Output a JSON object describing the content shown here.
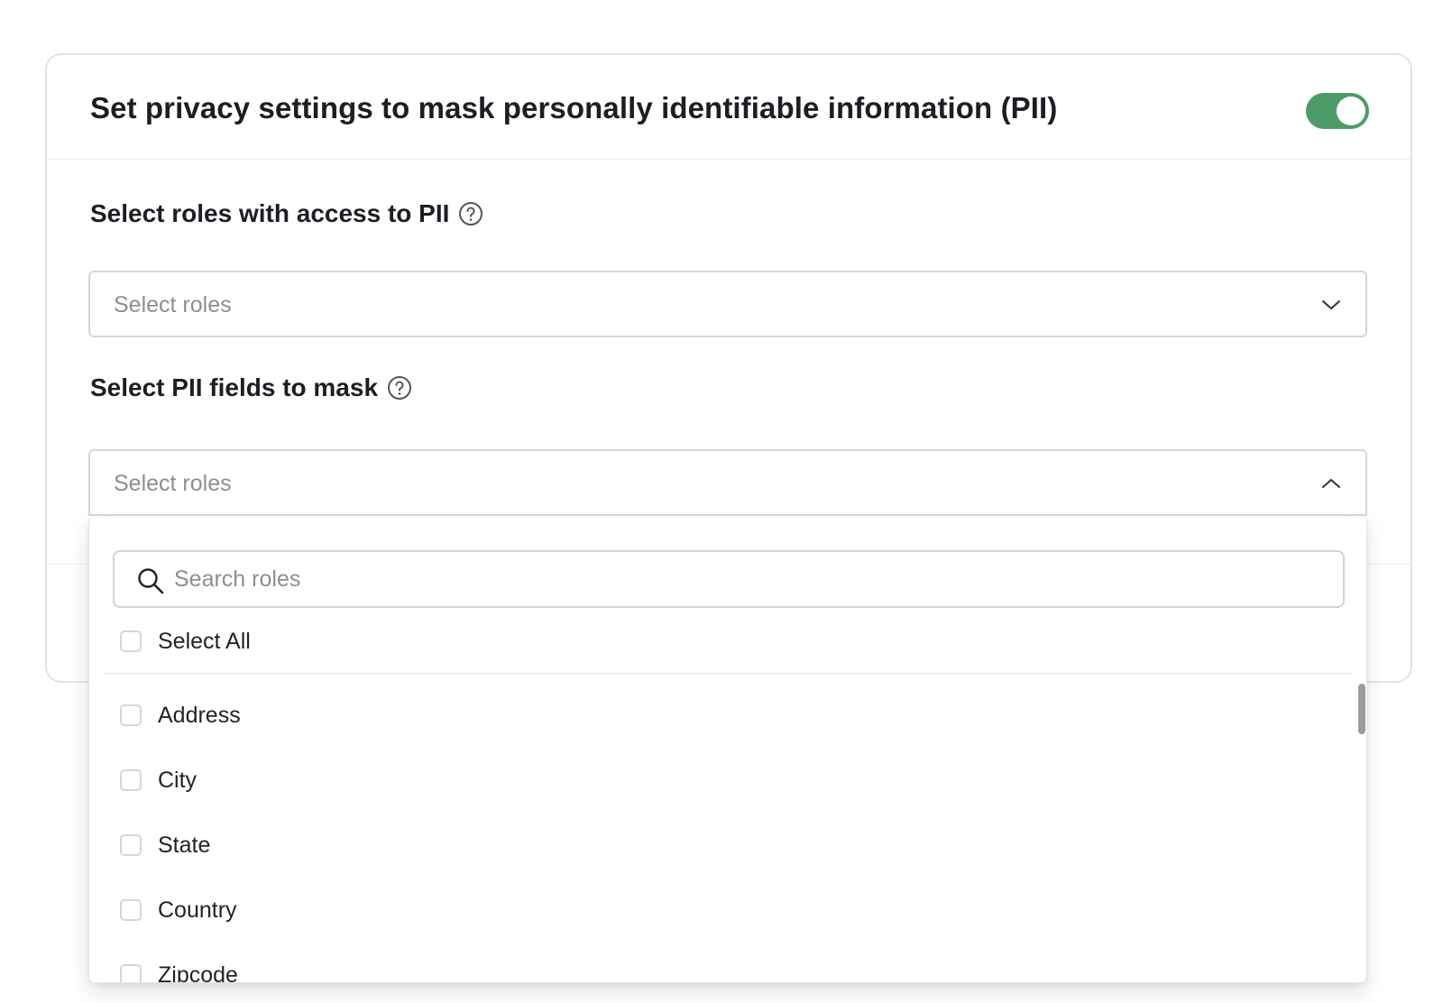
{
  "card": {
    "title": "Set privacy settings to mask personally identifiable information (PII)",
    "pii_toggle_on": true,
    "toggle_color": "#4e9b6a"
  },
  "roles_field": {
    "label": "Select roles with access to PII",
    "placeholder": "Select roles",
    "help_icon": "question-circle-icon",
    "chevron_icon": "chevron-down-icon"
  },
  "pii_fields_field": {
    "label": "Select PII fields to mask",
    "placeholder": "Select roles",
    "help_icon": "question-circle-icon",
    "chevron_icon": "chevron-up-icon"
  },
  "dropdown": {
    "search_placeholder": "Search roles",
    "search_icon": "search-icon",
    "select_all_label": "Select All",
    "options": [
      {
        "label": "Address",
        "checked": false
      },
      {
        "label": "City",
        "checked": false
      },
      {
        "label": "State",
        "checked": false
      },
      {
        "label": "Country",
        "checked": false
      },
      {
        "label": "Zipcode",
        "checked": false
      }
    ]
  }
}
